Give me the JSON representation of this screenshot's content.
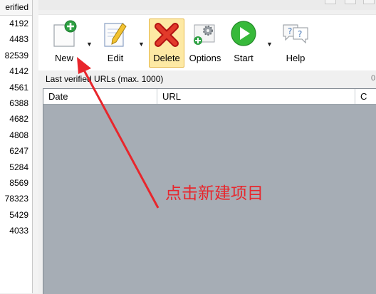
{
  "left_column": {
    "header": "erified",
    "values": [
      "4192",
      "4483",
      "82539",
      "4142",
      "4561",
      "6388",
      "4682",
      "4808",
      "6247",
      "5284",
      "8569",
      "78323",
      "5429",
      "4033"
    ]
  },
  "toolbar": {
    "buttons": [
      {
        "label": "New",
        "icon": "new-document-plus-icon"
      },
      {
        "label": "Edit",
        "icon": "edit-pencil-icon"
      },
      {
        "label": "Delete",
        "icon": "delete-x-icon"
      },
      {
        "label": "Options",
        "icon": "options-gear-icon"
      },
      {
        "label": "Start",
        "icon": "start-play-icon"
      },
      {
        "label": "Help",
        "icon": "help-question-icon"
      }
    ]
  },
  "urls_panel": {
    "caption": "Last verified URLs (max. 1000)",
    "caption_right": "0",
    "columns": [
      "Date",
      "URL",
      "C"
    ]
  },
  "annotation": {
    "text": "点击新建项目",
    "color": "#e8262c"
  },
  "colors": {
    "grid_bg": "#a6adb5",
    "delete_highlight": "#fde9a4",
    "annotation_red": "#e8262c",
    "start_green": "#37b93a",
    "new_green": "#2ea043"
  }
}
